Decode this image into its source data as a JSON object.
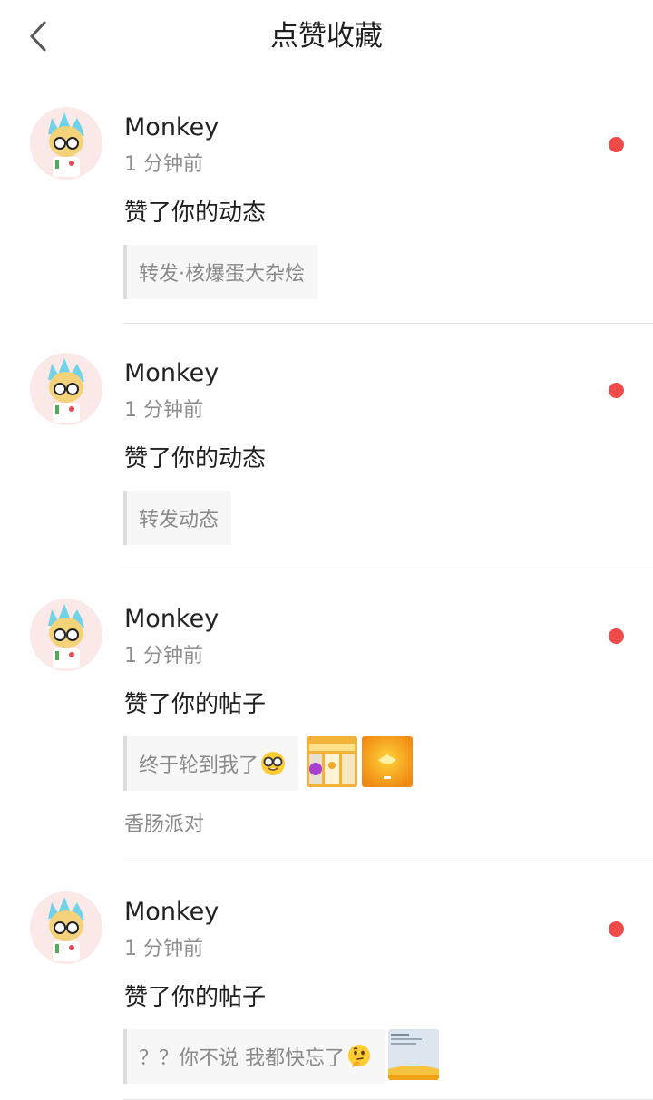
{
  "header": {
    "title": "点赞收藏",
    "back_icon": "chevron-left-icon"
  },
  "notifications": [
    {
      "user": "Monkey",
      "time": "1 分钟前",
      "action": "赞了你的动态",
      "quote": "转发·核爆蛋大杂烩",
      "emoji": null,
      "thumbnails": [],
      "topic": null,
      "unread": true
    },
    {
      "user": "Monkey",
      "time": "1 分钟前",
      "action": "赞了你的动态",
      "quote": "转发动态",
      "emoji": null,
      "thumbnails": [],
      "topic": null,
      "unread": true
    },
    {
      "user": "Monkey",
      "time": "1 分钟前",
      "action": "赞了你的帖子",
      "quote": "终于轮到我了",
      "emoji": "nerd-face-emoji",
      "thumbnails": [
        "game-screenshot-thumbnail",
        "orange-scene-thumbnail"
      ],
      "topic": "香肠派对",
      "unread": true
    },
    {
      "user": "Monkey",
      "time": "1 分钟前",
      "action": "赞了你的帖子",
      "quote": "？？你不说 我都快忘了",
      "emoji": "thinking-face-emoji",
      "thumbnails": [
        "screenshot-thumbnail"
      ],
      "topic": null,
      "unread": true
    }
  ],
  "colors": {
    "unread_dot": "#ef4b4b",
    "text_primary": "#1f1f1f",
    "text_secondary": "#8e8e8e",
    "quote_bg": "#f7f7f7",
    "quote_border": "#dcdcdc",
    "divider": "#e6e6e6"
  }
}
